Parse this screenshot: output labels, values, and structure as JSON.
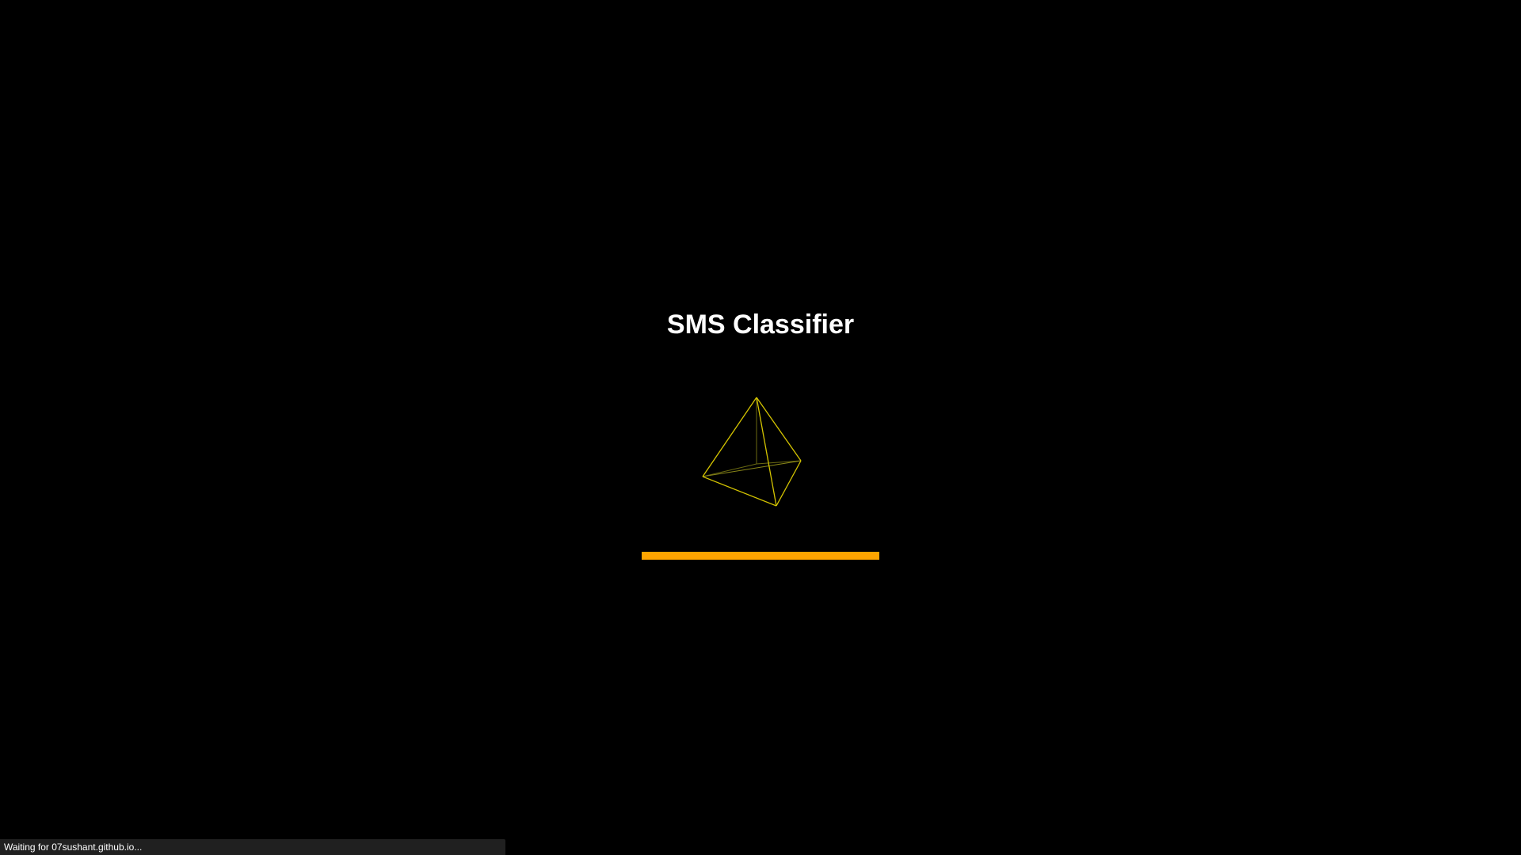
{
  "app": {
    "title": "SMS Classifier"
  },
  "loader": {
    "icon": "wireframe-tetrahedron-icon",
    "progress_percent": 100,
    "accent_color": "#FFA500",
    "wireframe_color": "#D4C400"
  },
  "status_bar": {
    "text": "Waiting for 07sushant.github.io..."
  }
}
